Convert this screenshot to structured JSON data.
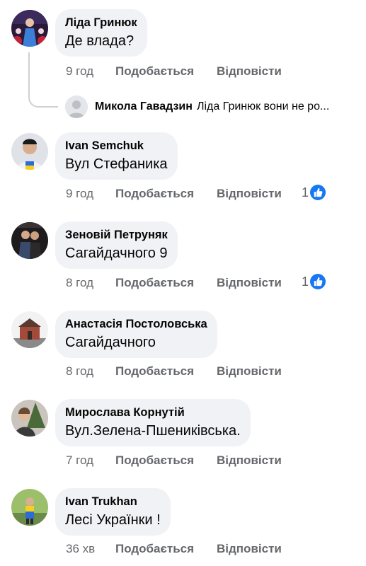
{
  "comments": [
    {
      "author": "Ліда Гринюк",
      "text": "Де влада?",
      "time": "9 год",
      "like_label": "Подобається",
      "reply_label": "Відповісти",
      "reply_preview": {
        "author": "Микола Гавадзин",
        "text": "Ліда Гринюк вони не ро..."
      }
    },
    {
      "author": "Ivan Semchuk",
      "text": "Вул Стефаника",
      "time": "9 год",
      "like_label": "Подобається",
      "reply_label": "Відповісти",
      "reactions": "1"
    },
    {
      "author": "Зеновій Петруняк",
      "text": "Сагайдачного 9",
      "time": "8 год",
      "like_label": "Подобається",
      "reply_label": "Відповісти",
      "reactions": "1"
    },
    {
      "author": "Анастасія Постоловська",
      "text": "Сагайдачного",
      "time": "8 год",
      "like_label": "Подобається",
      "reply_label": "Відповісти"
    },
    {
      "author": "Мирослава Корнутій",
      "text": "Вул.Зелена-Пшениківська.",
      "time": "7 год",
      "like_label": "Подобається",
      "reply_label": "Відповісти"
    },
    {
      "author": "Ivan Trukhan",
      "text": "Лесі Українки !",
      "time": "36 хв",
      "like_label": "Подобається",
      "reply_label": "Відповісти"
    }
  ],
  "icons": {
    "like_reaction": "thumbs-up-icon",
    "default_avatar": "default-avatar-icon"
  },
  "colors": {
    "bubble": "#f0f2f5",
    "meta_text": "#65676b",
    "like_blue": "#1877f2"
  }
}
